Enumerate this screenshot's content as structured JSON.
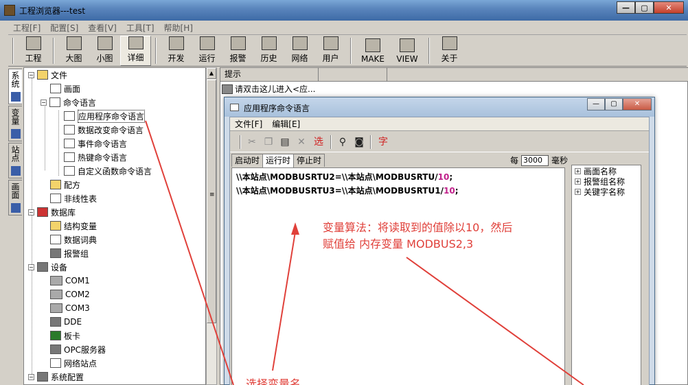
{
  "window": {
    "title": "工程浏览器---test"
  },
  "menubar": [
    "工程[F]",
    "配置[S]",
    "查看[V]",
    "工具[T]",
    "帮助[H]"
  ],
  "toolbar": {
    "project": "工程",
    "big_icon": "大图",
    "small_icon": "小图",
    "detail": "详细",
    "develop": "开发",
    "run": "运行",
    "alarm": "报警",
    "history": "历史",
    "network": "网络",
    "user": "用户",
    "make": "MAKE",
    "view": "VIEW",
    "about": "关于"
  },
  "vtabs": [
    "系统",
    "变量",
    "站点",
    "画面"
  ],
  "tree": {
    "file": "文件",
    "screen": "画面",
    "cmd_lang": "命令语言",
    "app_cmd": "应用程序命令语言",
    "data_change_cmd": "数据改变命令语言",
    "event_cmd": "事件命令语言",
    "hotkey_cmd": "热键命令语言",
    "custom_func_cmd": "自定义函数命令语言",
    "recipe": "配方",
    "nonlinear": "非线性表",
    "database": "数据库",
    "struct_var": "结构变量",
    "data_dict": "数据词典",
    "alarm_group": "报警组",
    "device": "设备",
    "com1": "COM1",
    "com2": "COM2",
    "com3": "COM3",
    "dde": "DDE",
    "board": "板卡",
    "opc": "OPC服务器",
    "net_station": "网络站点",
    "sys_config": "系统配置"
  },
  "content": {
    "header": "提示",
    "hint": "请双击这儿进入<应..."
  },
  "dialog": {
    "title": "应用程序命令语言",
    "menu_file": "文件[F]",
    "menu_edit": "编辑[E]",
    "select_label": "选",
    "char_label": "字",
    "tabs": [
      "启动时",
      "运行时",
      "停止时"
    ],
    "every_label": "每",
    "interval": "3000",
    "unit": "毫秒",
    "code": [
      {
        "text": "\\\\本站点\\MODBUSRTU2=\\\\本站点\\MODBUSRTU/",
        "num": "10",
        "end": ";"
      },
      {
        "text": "\\\\本站点\\MODBUSRTU3=\\\\本站点\\MODBUSRTU1/",
        "num": "10",
        "end": ";"
      }
    ],
    "side_tree": [
      "画面名称",
      "报警组名称",
      "关键字名称"
    ]
  },
  "annotations": {
    "line1": "变量算法：将读取到的值除以10，然后",
    "line2": "赋值给 内存变量 MODBUS2,3",
    "bottom": "选择变量名"
  },
  "colors": {
    "annotation": "#e0403a",
    "number_highlight": "#c0208a"
  }
}
